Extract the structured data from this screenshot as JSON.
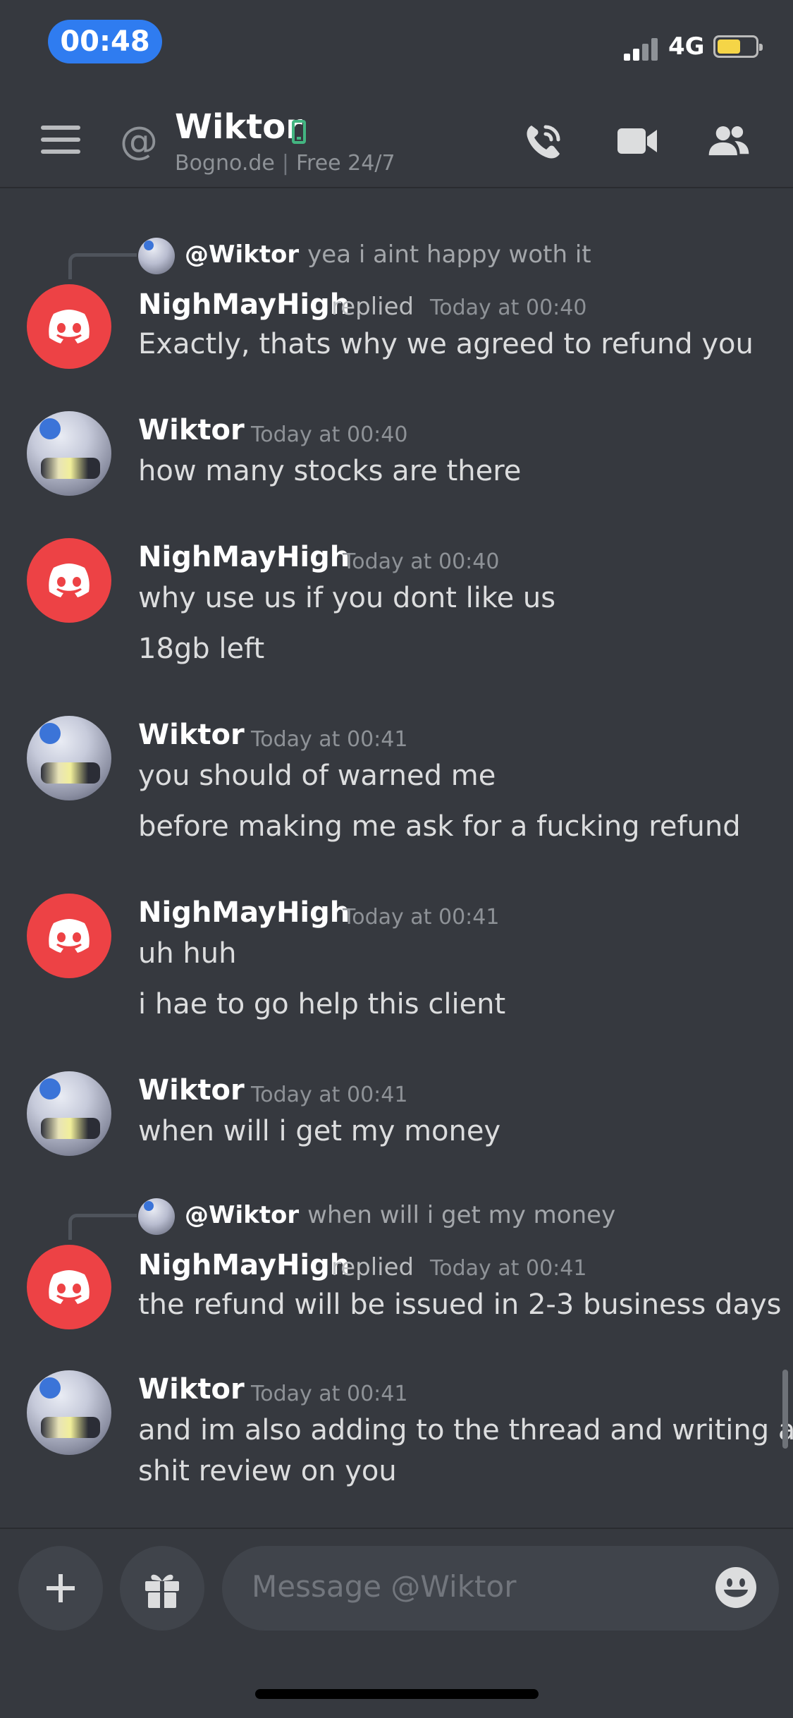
{
  "status_bar": {
    "time": "00:48",
    "network": "4G"
  },
  "header": {
    "channel_name": "Wiktor",
    "topic_site": "Bogno.de",
    "topic_tagline": "Free 24/7",
    "icons": [
      "menu-icon",
      "at-icon",
      "mobile-status-icon",
      "voice-call-icon",
      "video-call-icon",
      "members-icon"
    ]
  },
  "messages": [
    {
      "author": "NighMayHigh",
      "replied_label": "replied",
      "timestamp": "Today at 00:40",
      "reply_to": {
        "name": "@Wiktor",
        "content": "yea i aint happy woth it"
      },
      "lines": [
        "Exactly, thats why we agreed to refund you"
      ]
    },
    {
      "author": "Wiktor",
      "timestamp": "Today at 00:40",
      "lines": [
        "how many stocks are there"
      ]
    },
    {
      "author": "NighMayHigh",
      "timestamp": "Today at 00:40",
      "lines": [
        "why use us if you dont like us",
        "18gb left"
      ]
    },
    {
      "author": "Wiktor",
      "timestamp": "Today at 00:41",
      "lines": [
        "you should of warned me",
        "before making me ask for a fucking refund"
      ]
    },
    {
      "author": "NighMayHigh",
      "timestamp": "Today at 00:41",
      "lines": [
        "uh huh",
        "i hae to go help this client"
      ]
    },
    {
      "author": "Wiktor",
      "timestamp": "Today at 00:41",
      "lines": [
        "when will i get my money"
      ]
    },
    {
      "author": "NighMayHigh",
      "replied_label": "replied",
      "timestamp": "Today at 00:41",
      "reply_to": {
        "name": "@Wiktor",
        "content": "when will i get my money"
      },
      "lines": [
        "the refund will be issued in 2-3 business days"
      ]
    },
    {
      "author": "Wiktor",
      "timestamp": "Today at 00:41",
      "lines": [
        "and im also adding to the thread and writing a",
        "shit review on you"
      ]
    }
  ],
  "composer": {
    "placeholder": "Message @Wiktor"
  },
  "colors": {
    "background": "#36393f",
    "discord_red": "#ed4245",
    "online_green": "#43b581",
    "time_pill": "#2f7cf0"
  }
}
